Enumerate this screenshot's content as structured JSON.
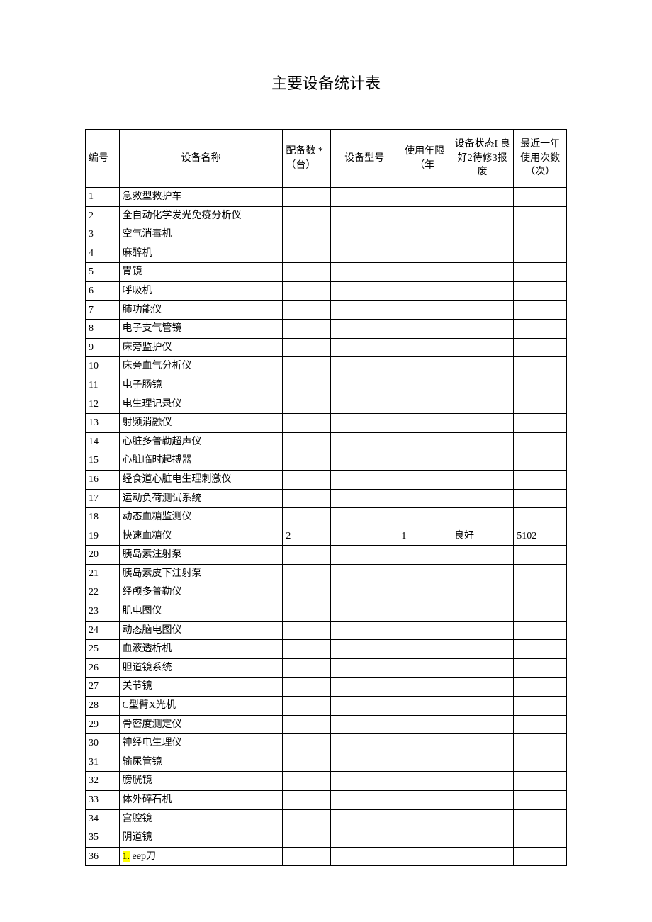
{
  "title": "主要设备统计表",
  "headers": {
    "id": "编号",
    "name": "设备名称",
    "qty": "配备数 *（台）",
    "model": "设备型号",
    "years": "使用年限（年",
    "status": "设备状态I 良好2待修3报废",
    "usage": "最近一年使用次数（次）"
  },
  "rows": [
    {
      "id": "1",
      "name": "急救型救护车",
      "qty": "",
      "model": "",
      "years": "",
      "status": "",
      "usage": ""
    },
    {
      "id": "2",
      "name": "全自动化学发光免疫分析仪",
      "qty": "",
      "model": "",
      "years": "",
      "status": "",
      "usage": ""
    },
    {
      "id": "3",
      "name": "空气消毒机",
      "qty": "",
      "model": "",
      "years": "",
      "status": "",
      "usage": ""
    },
    {
      "id": "4",
      "name": "麻醉机",
      "qty": "",
      "model": "",
      "years": "",
      "status": "",
      "usage": ""
    },
    {
      "id": "5",
      "name": "胃镜",
      "qty": "",
      "model": "",
      "years": "",
      "status": "",
      "usage": ""
    },
    {
      "id": "6",
      "name": "呼吸机",
      "qty": "",
      "model": "",
      "years": "",
      "status": "",
      "usage": ""
    },
    {
      "id": "7",
      "name": "肺功能仪",
      "qty": "",
      "model": "",
      "years": "",
      "status": "",
      "usage": ""
    },
    {
      "id": "8",
      "name": "电子支气管镜",
      "qty": "",
      "model": "",
      "years": "",
      "status": "",
      "usage": ""
    },
    {
      "id": "9",
      "name": "床旁监护仪",
      "qty": "",
      "model": "",
      "years": "",
      "status": "",
      "usage": ""
    },
    {
      "id": "10",
      "name": "床旁血气分析仪",
      "qty": "",
      "model": "",
      "years": "",
      "status": "",
      "usage": ""
    },
    {
      "id": "11",
      "name": "电子肠镜",
      "qty": "",
      "model": "",
      "years": "",
      "status": "",
      "usage": ""
    },
    {
      "id": "12",
      "name": "电生理记录仪",
      "qty": "",
      "model": "",
      "years": "",
      "status": "",
      "usage": ""
    },
    {
      "id": "13",
      "name": "射频消融仪",
      "qty": "",
      "model": "",
      "years": "",
      "status": "",
      "usage": ""
    },
    {
      "id": "14",
      "name": "心脏多普勒超声仪",
      "qty": "",
      "model": "",
      "years": "",
      "status": "",
      "usage": ""
    },
    {
      "id": "15",
      "name": "心脏临时起搏器",
      "qty": "",
      "model": "",
      "years": "",
      "status": "",
      "usage": ""
    },
    {
      "id": "16",
      "name": "经食道心脏电生理刺激仪",
      "qty": "",
      "model": "",
      "years": "",
      "status": "",
      "usage": ""
    },
    {
      "id": "17",
      "name": "运动负荷测试系统",
      "qty": "",
      "model": "",
      "years": "",
      "status": "",
      "usage": ""
    },
    {
      "id": "18",
      "name": "动态血糖监测仪",
      "qty": "",
      "model": "",
      "years": "",
      "status": "",
      "usage": ""
    },
    {
      "id": "19",
      "name": "快速血糖仪",
      "qty": "2",
      "model": "",
      "years": "1",
      "status": "良好",
      "usage": "5102"
    },
    {
      "id": "20",
      "name": "胰岛素注射泵",
      "qty": "",
      "model": "",
      "years": "",
      "status": "",
      "usage": ""
    },
    {
      "id": "21",
      "name": "胰岛素皮下注射泵",
      "qty": "",
      "model": "",
      "years": "",
      "status": "",
      "usage": ""
    },
    {
      "id": "22",
      "name": "经颅多普勒仪",
      "qty": "",
      "model": "",
      "years": "",
      "status": "",
      "usage": ""
    },
    {
      "id": "23",
      "name": "肌电图仪",
      "qty": "",
      "model": "",
      "years": "",
      "status": "",
      "usage": ""
    },
    {
      "id": "24",
      "name": "动态脑电图仪",
      "qty": "",
      "model": "",
      "years": "",
      "status": "",
      "usage": ""
    },
    {
      "id": "25",
      "name": "血液透析机",
      "qty": "",
      "model": "",
      "years": "",
      "status": "",
      "usage": ""
    },
    {
      "id": "26",
      "name": "胆道镜系统",
      "qty": "",
      "model": "",
      "years": "",
      "status": "",
      "usage": ""
    },
    {
      "id": "27",
      "name": "关节镜",
      "qty": "",
      "model": "",
      "years": "",
      "status": "",
      "usage": ""
    },
    {
      "id": "28",
      "name": "C型臂X光机",
      "qty": "",
      "model": "",
      "years": "",
      "status": "",
      "usage": ""
    },
    {
      "id": "29",
      "name": "骨密度测定仪",
      "qty": "",
      "model": "",
      "years": "",
      "status": "",
      "usage": ""
    },
    {
      "id": "30",
      "name": "神经电生理仪",
      "qty": "",
      "model": "",
      "years": "",
      "status": "",
      "usage": ""
    },
    {
      "id": "31",
      "name": "输尿管镜",
      "qty": "",
      "model": "",
      "years": "",
      "status": "",
      "usage": ""
    },
    {
      "id": "32",
      "name": "膀胱镜",
      "qty": "",
      "model": "",
      "years": "",
      "status": "",
      "usage": ""
    },
    {
      "id": "33",
      "name": "体外碎石机",
      "qty": "",
      "model": "",
      "years": "",
      "status": "",
      "usage": ""
    },
    {
      "id": "34",
      "name": "宫腔镜",
      "qty": "",
      "model": "",
      "years": "",
      "status": "",
      "usage": ""
    },
    {
      "id": "35",
      "name": "阴道镜",
      "qty": "",
      "model": "",
      "years": "",
      "status": "",
      "usage": ""
    },
    {
      "id": "36",
      "name_prefix_hl": "1.",
      "name_rest": " eep刀",
      "qty": "",
      "model": "",
      "years": "",
      "status": "",
      "usage": ""
    }
  ]
}
